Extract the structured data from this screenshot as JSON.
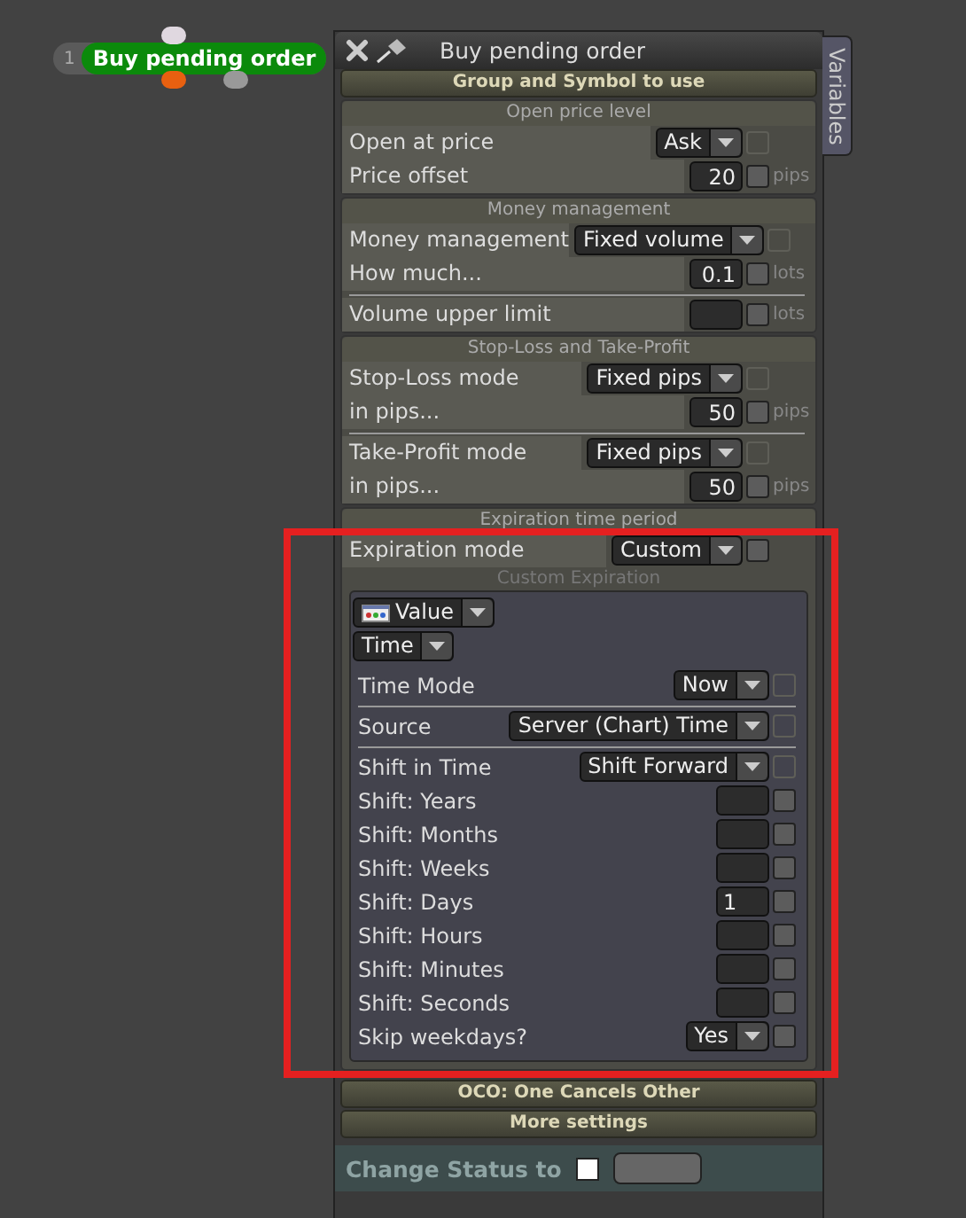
{
  "node": {
    "number": "1",
    "label": "Buy pending order"
  },
  "panel": {
    "title": "Buy pending order",
    "side_tab": "Variables",
    "sections": [
      {
        "kind": "header",
        "title": "Group and Symbol to use"
      },
      {
        "kind": "group",
        "title": "Open price level",
        "blocks": [
          [
            {
              "kind": "select",
              "label": "Open at price",
              "value": "Ask",
              "checked": false,
              "disabled": true
            },
            {
              "kind": "number",
              "label": "Price offset",
              "value": "20",
              "unit": "pips",
              "checked": false,
              "disabled": false
            }
          ]
        ]
      },
      {
        "kind": "group",
        "title": "Money management",
        "blocks": [
          [
            {
              "kind": "select",
              "label": "Money management",
              "value": "Fixed volume",
              "checked": false,
              "disabled": true
            },
            {
              "kind": "number",
              "label": "How much...",
              "value": "0.1",
              "unit": "lots",
              "checked": false,
              "disabled": false
            }
          ],
          [
            {
              "kind": "number",
              "label": "Volume upper limit",
              "unit": "lots",
              "checked": false,
              "disabled": false
            }
          ]
        ]
      },
      {
        "kind": "group",
        "title": "Stop-Loss and Take-Profit",
        "blocks": [
          [
            {
              "kind": "select",
              "label": "Stop-Loss mode",
              "value": "Fixed pips",
              "checked": false,
              "disabled": true
            },
            {
              "kind": "number",
              "label": "in pips...",
              "value": "50",
              "unit": "pips",
              "checked": false,
              "disabled": false
            }
          ],
          [
            {
              "kind": "select",
              "label": "Take-Profit mode",
              "value": "Fixed pips",
              "checked": false,
              "disabled": true
            },
            {
              "kind": "number",
              "label": "in pips...",
              "value": "50",
              "unit": "pips",
              "checked": false,
              "disabled": false
            }
          ]
        ]
      },
      {
        "kind": "group",
        "title": "Expiration time period",
        "highlighted": true,
        "blocks": [
          [
            {
              "kind": "select",
              "label": "Expiration mode",
              "value": "Custom",
              "checked": false,
              "disabled": false
            }
          ]
        ],
        "custom": {
          "title": "Custom Expiration",
          "value_select": "Value",
          "type_select": "Time",
          "blocks": [
            [
              {
                "kind": "select",
                "label": "Time Mode",
                "value": "Now",
                "checked": false,
                "disabled": true
              }
            ],
            [
              {
                "kind": "select",
                "label": "Source",
                "value": "Server (Chart) Time",
                "checked": false,
                "disabled": true
              }
            ],
            [
              {
                "kind": "select",
                "label": "Shift in Time",
                "value": "Shift Forward",
                "checked": false,
                "disabled": true
              },
              {
                "kind": "number",
                "label": "Shift: Years",
                "checked": false,
                "disabled": false
              },
              {
                "kind": "number",
                "label": "Shift: Months",
                "checked": false,
                "disabled": false
              },
              {
                "kind": "number",
                "label": "Shift: Weeks",
                "checked": false,
                "disabled": false
              },
              {
                "kind": "number",
                "label": "Shift: Days",
                "value": "1",
                "checked": false,
                "disabled": false
              },
              {
                "kind": "number",
                "label": "Shift: Hours",
                "checked": false,
                "disabled": false
              },
              {
                "kind": "number",
                "label": "Shift: Minutes",
                "checked": false,
                "disabled": false
              },
              {
                "kind": "number",
                "label": "Shift: Seconds",
                "checked": false,
                "disabled": false
              },
              {
                "kind": "select",
                "label": "Skip weekdays?",
                "value": "Yes",
                "checked": false,
                "disabled": false
              }
            ]
          ]
        }
      },
      {
        "kind": "header",
        "title": "OCO: One Cancels Other"
      },
      {
        "kind": "header",
        "title": "More settings"
      }
    ],
    "status_row": {
      "label": "Change Status to",
      "checked": false
    }
  }
}
